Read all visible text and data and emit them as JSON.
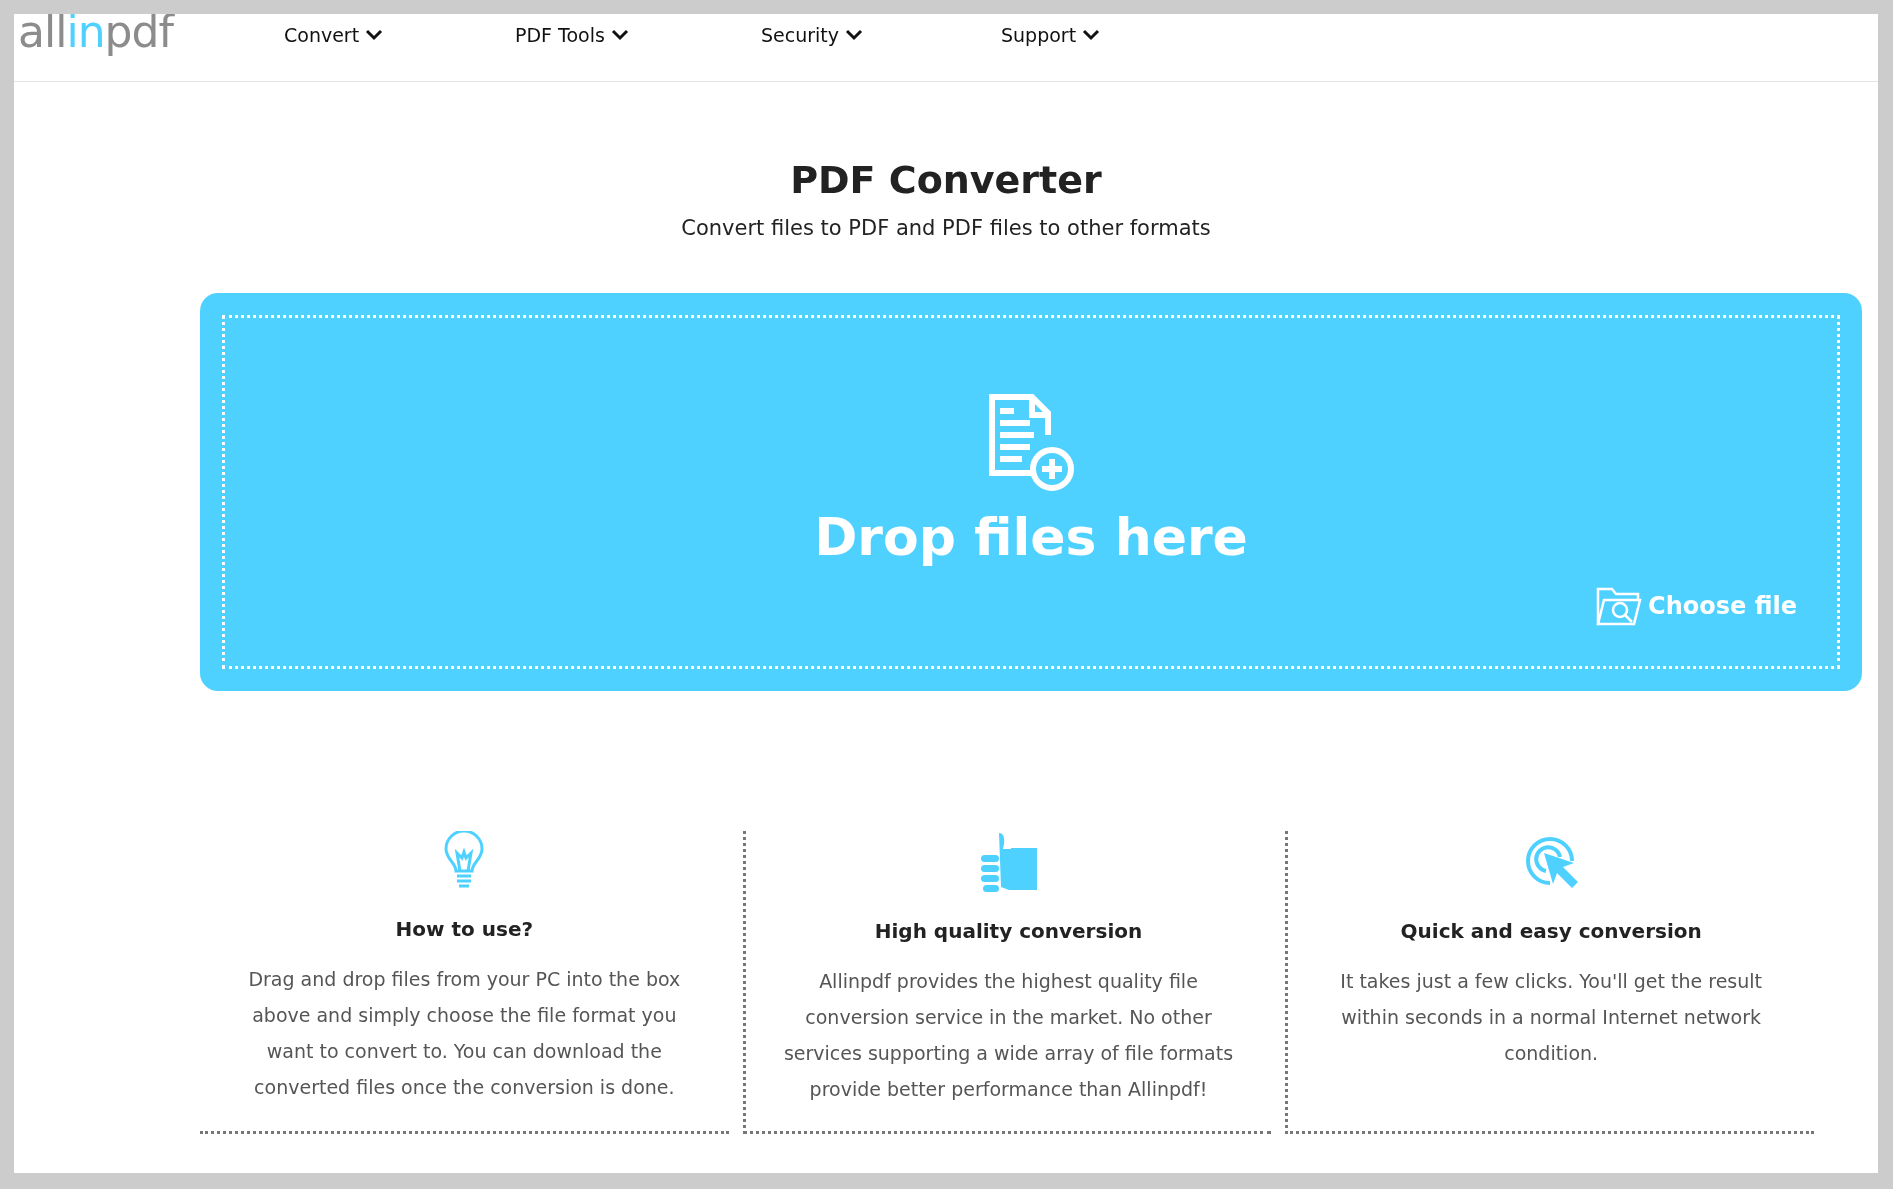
{
  "header": {
    "logo": [
      {
        "text": "all",
        "accent": false
      },
      {
        "text": "in",
        "accent": true
      },
      {
        "text": "pdf",
        "accent": false
      }
    ],
    "nav": [
      {
        "label": "Convert"
      },
      {
        "label": "PDF Tools"
      },
      {
        "label": "Security"
      },
      {
        "label": "Support"
      }
    ]
  },
  "hero": {
    "title": "PDF Converter",
    "subtitle": "Convert files to PDF and PDF files to other formats"
  },
  "dropzone": {
    "text": "Drop files here",
    "button": "Choose file"
  },
  "features": [
    {
      "kind": "bulb",
      "title": "How to use?",
      "text": "Drag and drop files from your PC into the box above and simply choose the file format you want to convert to. You can download the converted files once the conversion is done."
    },
    {
      "kind": "thumb",
      "title": "High quality conversion",
      "text": "Allinpdf provides the highest quality file conversion service in the market. No other services supporting a wide array of file formats provide better performance than Allinpdf!"
    },
    {
      "kind": "click",
      "title": "Quick and easy conversion",
      "text": "It takes just a few clicks. You'll get the result within seconds in a normal Internet network condition."
    }
  ]
}
